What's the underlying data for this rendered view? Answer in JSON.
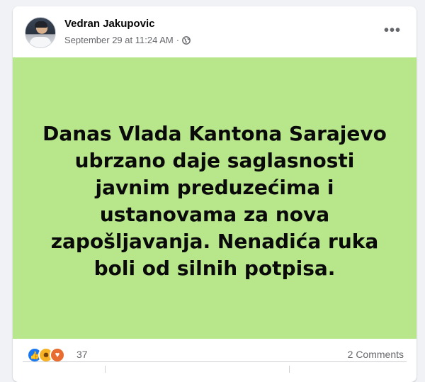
{
  "post": {
    "author": "Vedran Jakupovic",
    "timestamp": "September 29 at 11:24 AM",
    "separator": "·",
    "more_label": "•••",
    "text": "Danas Vlada Kantona Sarajevo ubrzano daje saglasnosti javnim preduzećima i ustanovama za nova zapošljavanja. Nenadića ruka boli od silnih potpisa.",
    "background_color": "#b8e68a"
  },
  "engagement": {
    "reaction_icons": [
      "like-icon",
      "haha-icon",
      "care-icon"
    ],
    "reaction_count": "37",
    "comments": "2 Comments"
  }
}
